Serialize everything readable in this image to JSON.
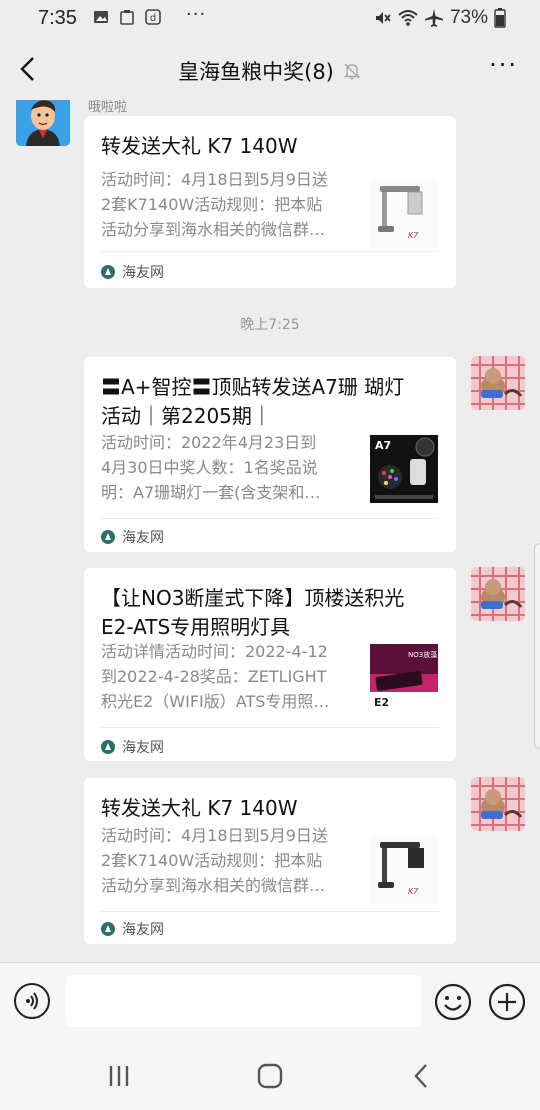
{
  "status_bar": {
    "time": "7:35",
    "dots": "···",
    "battery": "73%",
    "icons": [
      "image-icon",
      "clipboard-icon",
      "douyin-icon",
      "mute-icon",
      "wifi-icon",
      "airplane-icon",
      "battery-icon"
    ]
  },
  "header": {
    "title": "皇海鱼粮中奖(8)",
    "muted_icon": "bell-off-icon",
    "more_label": "···"
  },
  "messages": {
    "sender_name": "哦啦啦",
    "time_separator": "晚上7:25",
    "cards": [
      {
        "title": "转发送大礼 K7 140W",
        "desc_lines": [
          "活动时间：4月18日到5月9日送",
          "2套K7140W活动规则：把本贴",
          "活动分享到海水相关的微信群…"
        ],
        "thumb_caption": "K7",
        "source": "海友网",
        "side": "left"
      },
      {
        "title_lines": [
          "〓A+智控〓顶贴转发送A7珊 瑚灯",
          "活动｜第2205期｜"
        ],
        "desc_lines": [
          "活动时间：2022年4月23日到",
          "4月30日中奖人数：1名奖品说",
          "明：A7珊瑚灯一套(含支架和…"
        ],
        "thumb_caption": "A7",
        "source": "海友网",
        "side": "right"
      },
      {
        "title_lines": [
          "【让NO3断崖式下降】顶楼送积光",
          "E2-ATS专用照明灯具"
        ],
        "desc_lines": [
          "活动详情活动时间：2022-4-12",
          "到2022-4-28奖品：ZETLIGHT",
          "积光E2（WIFI版）ATS专用照…"
        ],
        "thumb_caption": "NO3放藻",
        "thumb_caption2": "E2",
        "source": "海友网",
        "side": "right"
      },
      {
        "title": "转发送大礼 K7 140W",
        "desc_lines": [
          "活动时间：4月18日到5月9日送",
          "2套K7140W活动规则：把本贴",
          "活动分享到海水相关的微信群…"
        ],
        "thumb_caption": "K7",
        "source": "海友网",
        "side": "right"
      }
    ]
  },
  "input_bar": {
    "placeholder": "",
    "voice_icon": "voice-icon",
    "emoji_icon": "emoji-icon",
    "plus_icon": "plus-icon"
  },
  "nav_bar": {
    "icons": [
      "recents-icon",
      "home-icon",
      "back-icon"
    ]
  }
}
